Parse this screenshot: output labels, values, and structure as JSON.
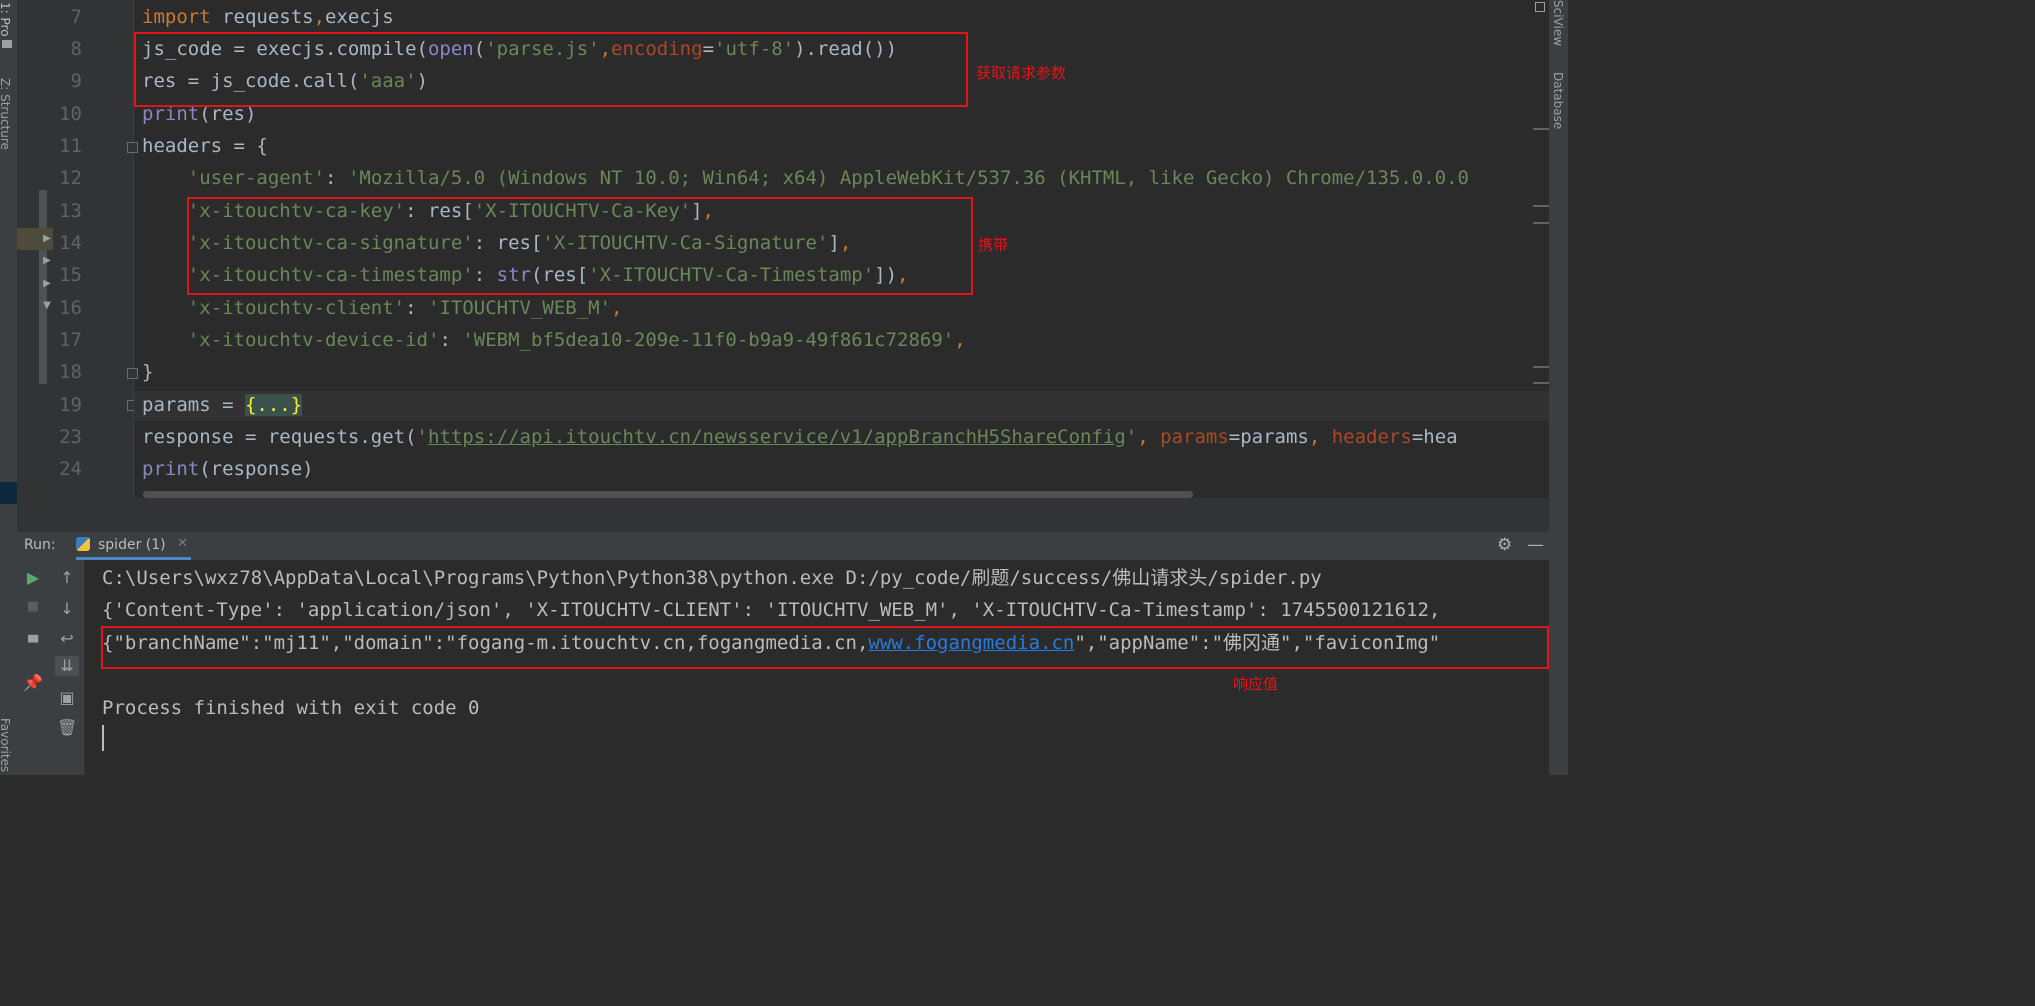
{
  "side_tabs": {
    "project": "1: Pro",
    "structure": "Z: Structure",
    "favorites": "Favorites",
    "sciview": "SciView",
    "database": "Database"
  },
  "editor": {
    "lines": [
      {
        "num": "7",
        "segments": [
          {
            "t": "import",
            "c": "kw"
          },
          {
            "t": " requests",
            "c": ""
          },
          {
            "t": ",",
            "c": "kw"
          },
          {
            "t": "execjs",
            "c": ""
          }
        ]
      },
      {
        "num": "8",
        "segments": [
          {
            "t": "js_code = execjs.compile(",
            "c": ""
          },
          {
            "t": "open",
            "c": "fn"
          },
          {
            "t": "(",
            "c": ""
          },
          {
            "t": "'parse.js'",
            "c": "str"
          },
          {
            "t": ",",
            "c": "kw"
          },
          {
            "t": "encoding",
            "c": "param"
          },
          {
            "t": "=",
            "c": ""
          },
          {
            "t": "'utf-8'",
            "c": "str"
          },
          {
            "t": ").read())",
            "c": ""
          }
        ]
      },
      {
        "num": "9",
        "segments": [
          {
            "t": "res = js_code.call(",
            "c": ""
          },
          {
            "t": "'aaa'",
            "c": "str"
          },
          {
            "t": ")",
            "c": ""
          }
        ]
      },
      {
        "num": "10",
        "segments": [
          {
            "t": "print",
            "c": "fn"
          },
          {
            "t": "(res)",
            "c": ""
          }
        ]
      },
      {
        "num": "11",
        "segments": [
          {
            "t": "headers = {",
            "c": ""
          }
        ]
      },
      {
        "num": "12",
        "segments": [
          {
            "t": "    ",
            "c": ""
          },
          {
            "t": "'user-agent'",
            "c": "str"
          },
          {
            "t": ": ",
            "c": ""
          },
          {
            "t": "'Mozilla/5.0 (Windows NT 10.0; Win64; x64) AppleWebKit/537.36 (KHTML, like Gecko) Chrome/135.0.0.0",
            "c": "str"
          }
        ]
      },
      {
        "num": "13",
        "segments": [
          {
            "t": "    ",
            "c": ""
          },
          {
            "t": "'x-itouchtv-ca-key'",
            "c": "str"
          },
          {
            "t": ": res[",
            "c": ""
          },
          {
            "t": "'X-ITOUCHTV-Ca-Key'",
            "c": "str"
          },
          {
            "t": "]",
            "c": ""
          },
          {
            "t": ",",
            "c": "kw"
          }
        ]
      },
      {
        "num": "14",
        "segments": [
          {
            "t": "    ",
            "c": ""
          },
          {
            "t": "'x-itouchtv-ca-signature'",
            "c": "str"
          },
          {
            "t": ": res[",
            "c": ""
          },
          {
            "t": "'X-ITOUCHTV-Ca-Signature'",
            "c": "str"
          },
          {
            "t": "]",
            "c": ""
          },
          {
            "t": ",",
            "c": "kw"
          }
        ]
      },
      {
        "num": "15",
        "segments": [
          {
            "t": "    ",
            "c": ""
          },
          {
            "t": "'x-itouchtv-ca-timestamp'",
            "c": "str"
          },
          {
            "t": ": ",
            "c": ""
          },
          {
            "t": "str",
            "c": "fn"
          },
          {
            "t": "(res[",
            "c": ""
          },
          {
            "t": "'X-ITOUCHTV-Ca-Timestamp'",
            "c": "str"
          },
          {
            "t": "])",
            "c": ""
          },
          {
            "t": ",",
            "c": "kw"
          }
        ]
      },
      {
        "num": "16",
        "segments": [
          {
            "t": "    ",
            "c": ""
          },
          {
            "t": "'x-itouchtv-client'",
            "c": "str"
          },
          {
            "t": ": ",
            "c": ""
          },
          {
            "t": "'ITOUCHTV_WEB_M'",
            "c": "str"
          },
          {
            "t": ",",
            "c": "kw"
          }
        ]
      },
      {
        "num": "17",
        "segments": [
          {
            "t": "    ",
            "c": ""
          },
          {
            "t": "'x-itouchtv-device-id'",
            "c": "str"
          },
          {
            "t": ": ",
            "c": ""
          },
          {
            "t": "'WEBM_bf5dea10-209e-11f0-b9a9-49f861c72869'",
            "c": "str"
          },
          {
            "t": ",",
            "c": "kw"
          }
        ]
      },
      {
        "num": "18",
        "segments": [
          {
            "t": "}",
            "c": ""
          }
        ]
      },
      {
        "num": "19",
        "segments": [
          {
            "t": "params = ",
            "c": ""
          },
          {
            "t": "{...}",
            "c": "brace"
          }
        ]
      },
      {
        "num": "23",
        "segments": [
          {
            "t": "response = requests.get(",
            "c": ""
          },
          {
            "t": "'",
            "c": "str"
          },
          {
            "t": "https://api.itouchtv.cn/newsservice/v1/appBranchH5ShareConfig",
            "c": "url"
          },
          {
            "t": "'",
            "c": "str"
          },
          {
            "t": ", ",
            "c": "kw"
          },
          {
            "t": "params",
            "c": "param"
          },
          {
            "t": "=params",
            "c": ""
          },
          {
            "t": ", ",
            "c": "kw"
          },
          {
            "t": "headers",
            "c": "param"
          },
          {
            "t": "=hea",
            "c": ""
          }
        ]
      },
      {
        "num": "24",
        "segments": [
          {
            "t": "print",
            "c": "fn"
          },
          {
            "t": "(response)",
            "c": ""
          }
        ]
      }
    ],
    "annotations": {
      "request_params": "获取请求参数",
      "carry": "携带",
      "response_value": "响应值"
    }
  },
  "run_panel": {
    "label": "Run:",
    "tab_label": "spider (1)",
    "output": {
      "command": "C:\\Users\\wxz78\\AppData\\Local\\Programs\\Python\\Python38\\python.exe D:/py_code/刷题/success/佛山请求头/spider.py",
      "headers_line": "{'Content-Type': 'application/json', 'X-ITOUCHTV-CLIENT': 'ITOUCHTV_WEB_M', 'X-ITOUCHTV-Ca-Timestamp': 1745500121612,",
      "response_prefix": "{\"branchName\":\"mj11\",\"domain\":\"fogang-m.itouchtv.cn,fogangmedia.cn,",
      "response_link": "www.fogangmedia.cn",
      "response_suffix": "\",\"appName\":\"佛冈通\",\"faviconImg\"",
      "exit_message": "Process finished with exit code 0"
    }
  },
  "colors": {
    "editor_bg": "#2b2b2b",
    "annotation_red": "#e0151b",
    "keyword": "#cc7832",
    "string": "#6a8759",
    "builtin": "#8888c6",
    "param": "#aa4926",
    "run_green": "#59a869"
  }
}
